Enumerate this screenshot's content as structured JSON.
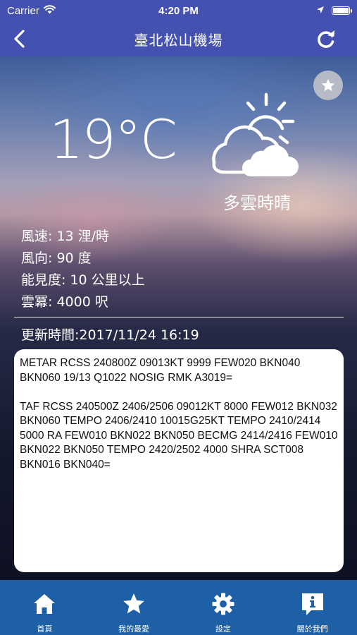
{
  "status_bar": {
    "carrier": "Carrier",
    "time": "4:20 PM",
    "battery_level": 1.0
  },
  "nav": {
    "title": "臺北松山機場",
    "back_icon": "chevron-left-icon",
    "refresh_icon": "refresh-icon"
  },
  "weather": {
    "temperature": "19°C",
    "condition": "多雲時晴",
    "condition_icon": "partly-cloudy-icon",
    "details": [
      "風速: 13 浬/時",
      "風向: 90 度",
      "能見度: 10 公里以上",
      "雲冪: 4000 呎"
    ],
    "updated": "更新時間:2017/11/24 16:19"
  },
  "report": {
    "metar": "METAR RCSS 240800Z 09013KT 9999 FEW020 BKN040 BKN060 19/13 Q1022 NOSIG RMK A3019=",
    "taf": "TAF RCSS 240500Z 2406/2506 09012KT 8000 FEW012 BKN032 BKN060 TEMPO 2406/2410 10015G25KT TEMPO 2410/2414 5000 RA FEW010 BKN022 BKN050 BECMG 2414/2416 FEW010 BKN022 BKN050 TEMPO 2420/2502 4000 SHRA SCT008 BKN016 BKN040="
  },
  "tabs": [
    {
      "label": "首頁",
      "icon": "home-icon"
    },
    {
      "label": "我的最愛",
      "icon": "star-icon"
    },
    {
      "label": "設定",
      "icon": "gear-icon"
    },
    {
      "label": "關於我們",
      "icon": "info-icon"
    }
  ],
  "colors": {
    "nav_bar": "#4551b0",
    "tab_bar": "#1d60a6",
    "report_background": "#ffffff"
  }
}
